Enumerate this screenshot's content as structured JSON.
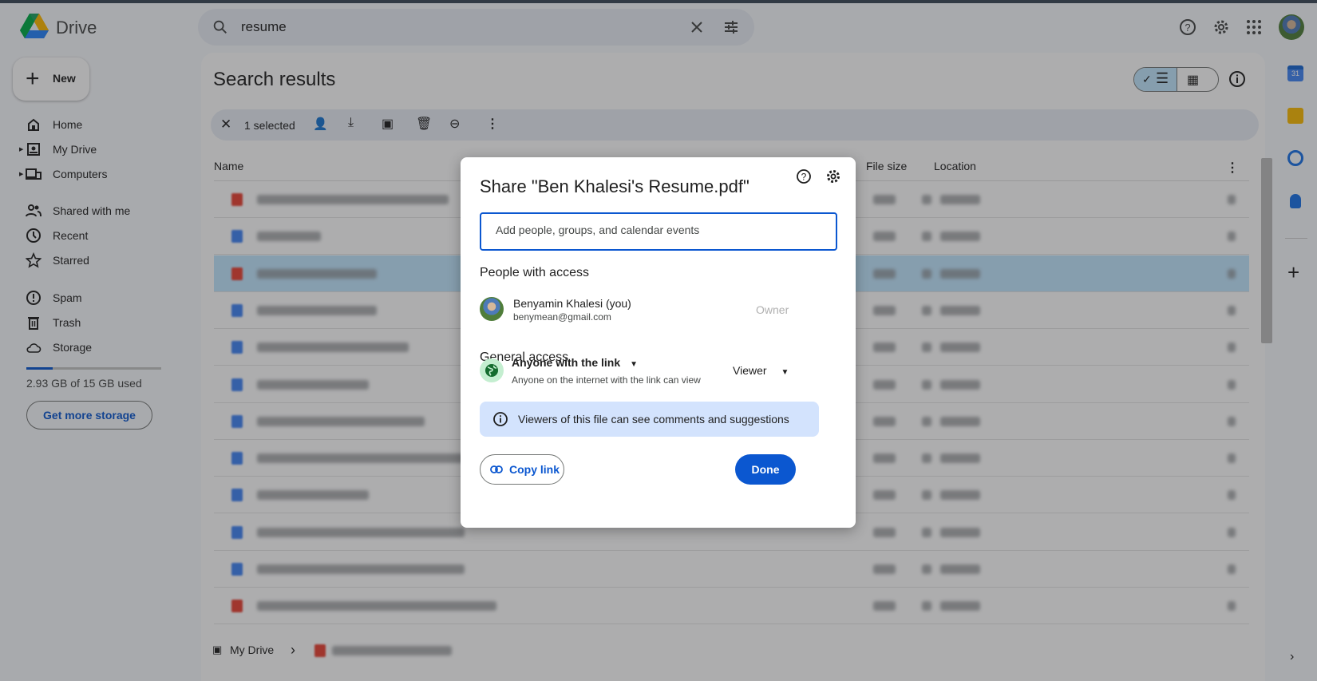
{
  "app": {
    "name": "Drive"
  },
  "search": {
    "query": "resume"
  },
  "sidebar": {
    "new_label": "New",
    "items": [
      {
        "label": "Home",
        "icon": "home-icon"
      },
      {
        "label": "My Drive",
        "icon": "my-drive-icon"
      },
      {
        "label": "Computers",
        "icon": "computers-icon"
      },
      {
        "label": "Shared with me",
        "icon": "shared-icon"
      },
      {
        "label": "Recent",
        "icon": "clock-icon"
      },
      {
        "label": "Starred",
        "icon": "star-icon"
      },
      {
        "label": "Spam",
        "icon": "spam-icon"
      },
      {
        "label": "Trash",
        "icon": "trash-icon"
      },
      {
        "label": "Storage",
        "icon": "cloud-icon"
      }
    ],
    "storage": {
      "used_fraction": 0.195,
      "text": "2.93 GB of 15 GB used",
      "button": "Get more storage"
    }
  },
  "main": {
    "title": "Search results",
    "selection": {
      "text": "1 selected"
    },
    "columns": {
      "name": "Name",
      "size": "File size",
      "location": "Location"
    },
    "rows": [
      {
        "type": "pdf"
      },
      {
        "type": "doc"
      },
      {
        "type": "pdf",
        "selected": true
      },
      {
        "type": "doc"
      },
      {
        "type": "doc"
      },
      {
        "type": "doc"
      },
      {
        "type": "doc"
      },
      {
        "type": "doc"
      },
      {
        "type": "doc"
      },
      {
        "type": "doc"
      },
      {
        "type": "doc"
      },
      {
        "type": "pdf"
      }
    ],
    "breadcrumb": {
      "root": "My Drive"
    }
  },
  "dialog": {
    "title": "Share \"Ben Khalesi's Resume.pdf\"",
    "input_placeholder": "Add people, groups, and calendar events",
    "people_heading": "People with access",
    "person": {
      "name": "Benyamin Khalesi (you)",
      "email": "benymean@gmail.com",
      "role": "Owner"
    },
    "general_heading": "General access",
    "access": {
      "label": "Anyone with the link",
      "description": "Anyone on the internet with the link can view",
      "role": "Viewer"
    },
    "banner": "Viewers of this file can see comments and suggestions",
    "copy_link": "Copy link",
    "done": "Done"
  },
  "colors": {
    "accent": "#0b57d0",
    "selected_row": "#c2e7ff",
    "banner": "#d3e3fd"
  }
}
